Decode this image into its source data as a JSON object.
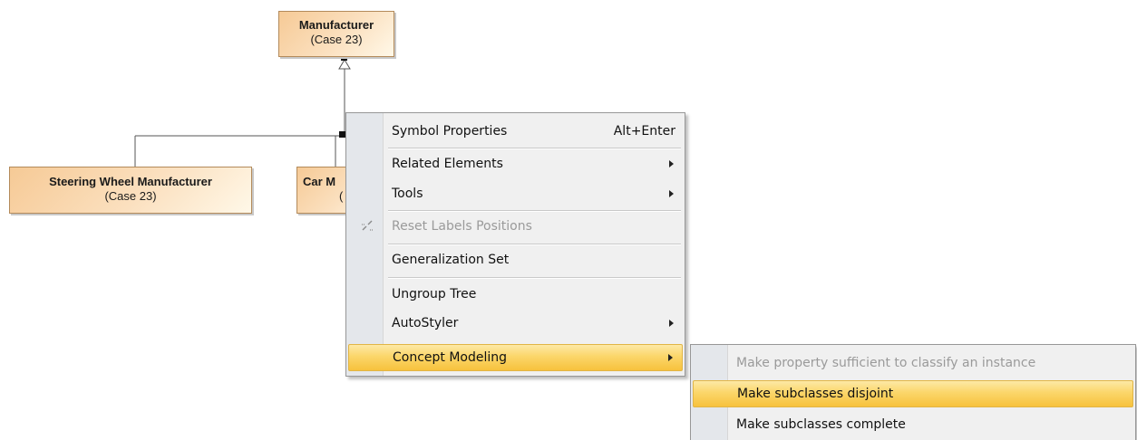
{
  "diagram": {
    "manufacturer": {
      "title": "Manufacturer",
      "subtitle": "(Case 23)"
    },
    "steering": {
      "title": "Steering Wheel Manufacturer",
      "subtitle": "(Case 23)"
    },
    "car": {
      "title": "Car M",
      "subtitle": "("
    }
  },
  "context_menu": {
    "items": [
      {
        "label": "Symbol Properties",
        "shortcut": "Alt+Enter"
      },
      {
        "label": "Related Elements"
      },
      {
        "label": "Tools"
      },
      {
        "label": "Reset Labels Positions",
        "icon": "reset-labels-icon"
      },
      {
        "label": "Generalization Set"
      },
      {
        "label": "Ungroup Tree"
      },
      {
        "label": "AutoStyler"
      },
      {
        "label": "Concept Modeling"
      }
    ]
  },
  "submenu": {
    "items": [
      {
        "label": "Make property sufficient to classify an instance"
      },
      {
        "label": "Make subclasses disjoint"
      },
      {
        "label": "Make subclasses complete"
      }
    ]
  },
  "colors": {
    "highlight": "#fbd66a",
    "box_fill": "#fbe0bf"
  }
}
